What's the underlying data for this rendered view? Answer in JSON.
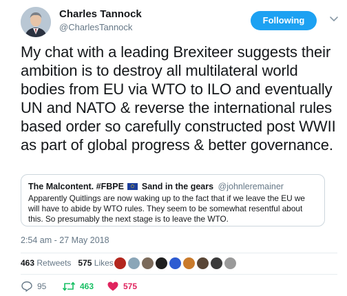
{
  "author": {
    "name": "Charles Tannock",
    "handle": "@CharlesTannock"
  },
  "follow_button": {
    "label": "Following"
  },
  "tweet": {
    "text": "My chat with a leading Brexiteer suggests their ambition is to destroy all multilateral world bodies from EU via WTO to ILO and eventually UN and NATO & reverse the international rules based order so carefully constructed post WWII as part of global progress & better governance."
  },
  "quoted": {
    "name_prefix": "The Malcontent. #FBPE",
    "name_suffix": "Sand in the gears",
    "handle": "@johnleremainer",
    "text": "Apparently Quitlings are now waking up to the fact that if we leave the EU we will have to abide by WTO rules. They seem to be somewhat resentful about this.  So presumably the next stage is to leave the WTO."
  },
  "timestamp": "2:54 am - 27 May 2018",
  "stats": {
    "retweets_count": "463",
    "retweets_label": "Retweets",
    "likes_count": "575",
    "likes_label": "Likes"
  },
  "likers": [
    {
      "name": "liker-1",
      "color": "#b3261e"
    },
    {
      "name": "liker-2",
      "color": "#8aa6b8"
    },
    {
      "name": "liker-3",
      "color": "#7b6a5a"
    },
    {
      "name": "liker-4",
      "color": "#1f1f1f"
    },
    {
      "name": "liker-5",
      "color": "#2d5bd1"
    },
    {
      "name": "liker-6",
      "color": "#c97a2b"
    },
    {
      "name": "liker-7",
      "color": "#5a4636"
    },
    {
      "name": "liker-8",
      "color": "#3b3b3b"
    },
    {
      "name": "liker-9",
      "color": "#9a9a9a"
    }
  ],
  "actions": {
    "reply_count": "95",
    "retweet_count": "463",
    "like_count": "575"
  },
  "colors": {
    "accent": "#1da1f2",
    "retweet": "#17bf63",
    "like": "#e0245e",
    "secondary_text": "#657786"
  }
}
